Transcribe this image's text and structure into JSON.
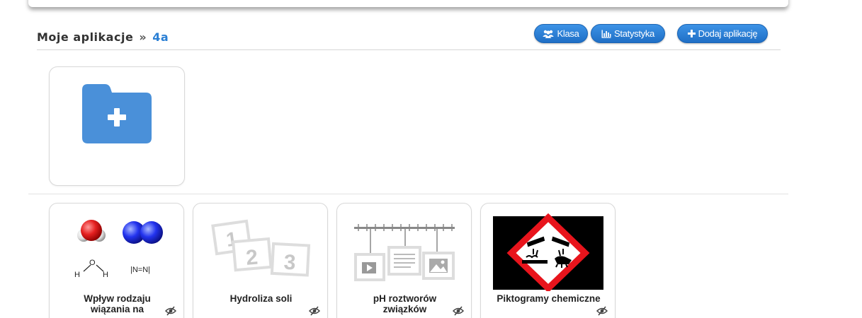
{
  "breadcrumb": {
    "root": "Moje aplikacje",
    "separator": "»",
    "current": "4a"
  },
  "toolbar": {
    "klasa_label": "Klasa",
    "statystyka_label": "Statystyka",
    "add_label": "Dodaj aplikację"
  },
  "colors": {
    "accent": "#2a7fd4",
    "button": "#2b80d8",
    "folder": "#4a90d9"
  },
  "new_folder": {
    "icon": "folder-plus-icon"
  },
  "apps": [
    {
      "title": "Wpływ rodzaju wiązania na",
      "thumb": "molecule-models-thumb",
      "hidden": true,
      "formula_o": "O",
      "formula_h": "H",
      "formula_n": "|N=N|"
    },
    {
      "title": "Hydroliza soli",
      "thumb": "numbered-cards-thumb",
      "hidden": true,
      "n1": "1",
      "n2": "2",
      "n3": "3"
    },
    {
      "title": "pH roztworów związków",
      "thumb": "media-board-thumb",
      "hidden": true
    },
    {
      "title": "Piktogramy chemiczne",
      "thumb": "ghs-corrosive-thumb",
      "hidden": true
    }
  ]
}
